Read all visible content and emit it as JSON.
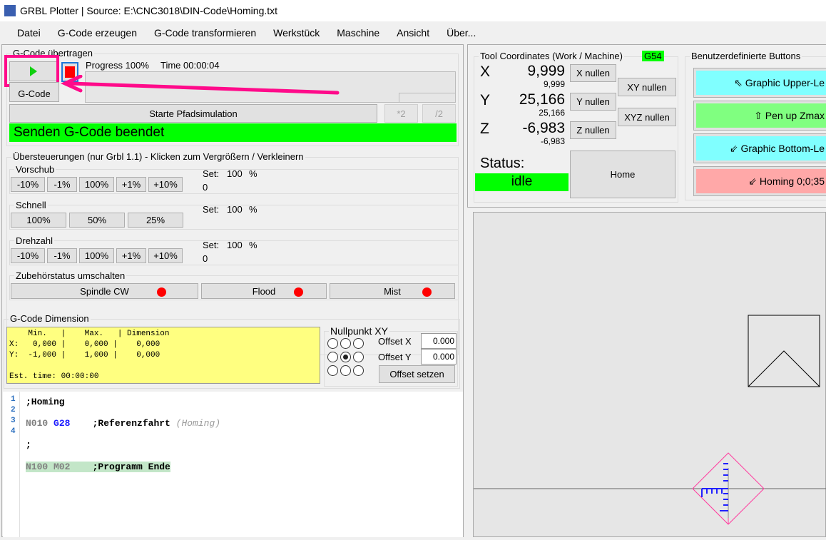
{
  "window": {
    "title": "GRBL Plotter | Source: E:\\CNC3018\\DIN-Code\\Homing.txt"
  },
  "menu": [
    "Datei",
    "G-Code erzeugen",
    "G-Code transformieren",
    "Werkstück",
    "Maschine",
    "Ansicht",
    "Über..."
  ],
  "send": {
    "group_label": "G-Code übertragen",
    "progress": "Progress 100%",
    "time": "Time 00:00:04",
    "gcode_button": "G-Code",
    "simulate_button": "Starte Pfadsimulation",
    "mul2": "*2",
    "div2": "/2",
    "status": "Senden G-Code beendet",
    "progress_value": 100
  },
  "override": {
    "group_label": "Übersteuerungen (nur Grbl 1.1) - Klicken zum Vergrößern / Verkleinern",
    "feed": {
      "label": "Vorschub",
      "buttons": [
        "-10%",
        "-1%",
        "100%",
        "+1%",
        "+10%"
      ],
      "set_label": "Set:",
      "set_value": "100",
      "unit": "%",
      "value": "0"
    },
    "rapid": {
      "label": "Schnell",
      "buttons": [
        "100%",
        "50%",
        "25%"
      ],
      "set_label": "Set:",
      "set_value": "100",
      "unit": "%"
    },
    "spindle": {
      "label": "Drehzahl",
      "buttons": [
        "-10%",
        "-1%",
        "100%",
        "+1%",
        "+10%"
      ],
      "set_label": "Set:",
      "set_value": "100",
      "unit": "%",
      "value": "0"
    }
  },
  "accessory": {
    "label": "Zubehörstatus umschalten",
    "buttons": [
      "Spindle CW",
      "Flood",
      "Mist"
    ]
  },
  "dimension": {
    "group_label": "G-Code Dimension",
    "header": "    Min.   |    Max.   | Dimension",
    "row_x": "X:   0,000 |    0,000 |    0,000",
    "row_y": "Y:  -1,000 |    1,000 |    0,000",
    "est_time": "Est. time: 00:00:00"
  },
  "zero": {
    "label": "Nullpunkt XY",
    "offset_x_label": "Offset X",
    "offset_x": "0.000",
    "offset_y_label": "Offset Y",
    "offset_y": "0.000",
    "set_button": "Offset setzen"
  },
  "editor": {
    "lines": [
      [
        {
          "t": ";Homing",
          "c": "#000"
        }
      ],
      [
        {
          "t": "N010 ",
          "c": "#808080"
        },
        {
          "t": "G28",
          "c": "#1a1aff"
        },
        {
          "t": "    ;Referenzfahrt ",
          "c": "#000"
        },
        {
          "t": "(Homing)",
          "c": "#999",
          "i": true
        }
      ],
      [
        {
          "t": ";",
          "c": "#000"
        }
      ],
      [
        {
          "t": "N100 M02",
          "c": "#808080"
        },
        {
          "t": "    ;Programm Ende",
          "c": "#000"
        }
      ]
    ]
  },
  "coords": {
    "group_label": "Tool Coordinates (Work / Machine)",
    "wcs": "G54",
    "axes": [
      {
        "name": "X",
        "work": "9,999",
        "machine": "9,999",
        "zero": "X nullen"
      },
      {
        "name": "Y",
        "work": "25,166",
        "machine": "25,166",
        "zero": "Y nullen"
      },
      {
        "name": "Z",
        "work": "-6,983",
        "machine": "-6,983",
        "zero": "Z nullen"
      }
    ],
    "xy_zero": "XY nullen",
    "xyz_zero": "XYZ nullen",
    "status_label": "Status:",
    "status": "idle",
    "home": "Home"
  },
  "custom": {
    "group_label": "Benutzerdefinierte Buttons",
    "buttons": [
      {
        "label": "⇖ Graphic Upper-Le",
        "color": "#80ffff"
      },
      {
        "label": "⇧ Pen up Zmax",
        "color": "#80ff80"
      },
      {
        "label": "⇙ Graphic Bottom-Le",
        "color": "#80ffff"
      },
      {
        "label": "⇙ Homing 0;0;35",
        "color": "#ffa8a8"
      }
    ]
  }
}
